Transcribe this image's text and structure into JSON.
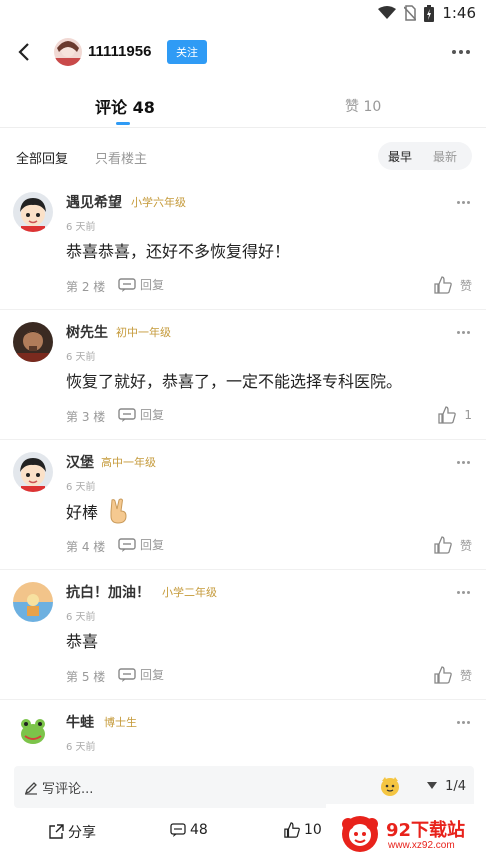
{
  "status": {
    "time": "1:46"
  },
  "header": {
    "username": "11111956",
    "follow_label": "关注"
  },
  "tabs": {
    "comments_label": "评论 48",
    "likes_label": "赞 10"
  },
  "filters": {
    "all_label": "全部回复",
    "owner_label": "只看楼主",
    "sort_early": "最早",
    "sort_late": "最新"
  },
  "comments": [
    {
      "name": "遇见希望",
      "grade": "小学六年级",
      "time": "6 天前",
      "text": "恭喜恭喜，还好不多恢复得好！",
      "floor": "第 2 楼",
      "reply_label": "回复",
      "like_label": "赞"
    },
    {
      "name": "树先生",
      "grade": "初中一年级",
      "time": "6 天前",
      "text": "恢复了就好，恭喜了，一定不能选择专科医院。",
      "floor": "第 3 楼",
      "reply_label": "回复",
      "like_label": "1"
    },
    {
      "name": "汉堡",
      "grade": "高中一年级",
      "time": "6 天前",
      "text": "好棒",
      "floor": "第 4 楼",
      "reply_label": "回复",
      "like_label": "赞"
    },
    {
      "name": "抗白！加油！",
      "grade": "小学二年级",
      "time": "6 天前",
      "text": "恭喜",
      "floor": "第 5 楼",
      "reply_label": "回复",
      "like_label": "赞"
    },
    {
      "name": "牛蛙",
      "grade": "博士生",
      "time": "6 天前"
    }
  ],
  "input": {
    "placeholder": "写评论...",
    "page": "1/4"
  },
  "bottom": {
    "share_label": "分享",
    "comment_count": "48",
    "like_count": "10"
  },
  "watermark": {
    "title": "92下载站",
    "url": "www.xz92.com"
  },
  "colors": {
    "accent": "#2f9bf5",
    "grade": "#c59a3a",
    "watermark": "#e8221b"
  },
  "icons": [
    "wifi-icon",
    "no-sim-icon",
    "battery-icon",
    "back-arrow-icon",
    "more-icon",
    "reply-icon",
    "thumbs-up-icon",
    "pencil-icon",
    "emoji-icon",
    "triangle-down-icon",
    "share-icon",
    "comment-icon",
    "victory-hand-emoji"
  ]
}
